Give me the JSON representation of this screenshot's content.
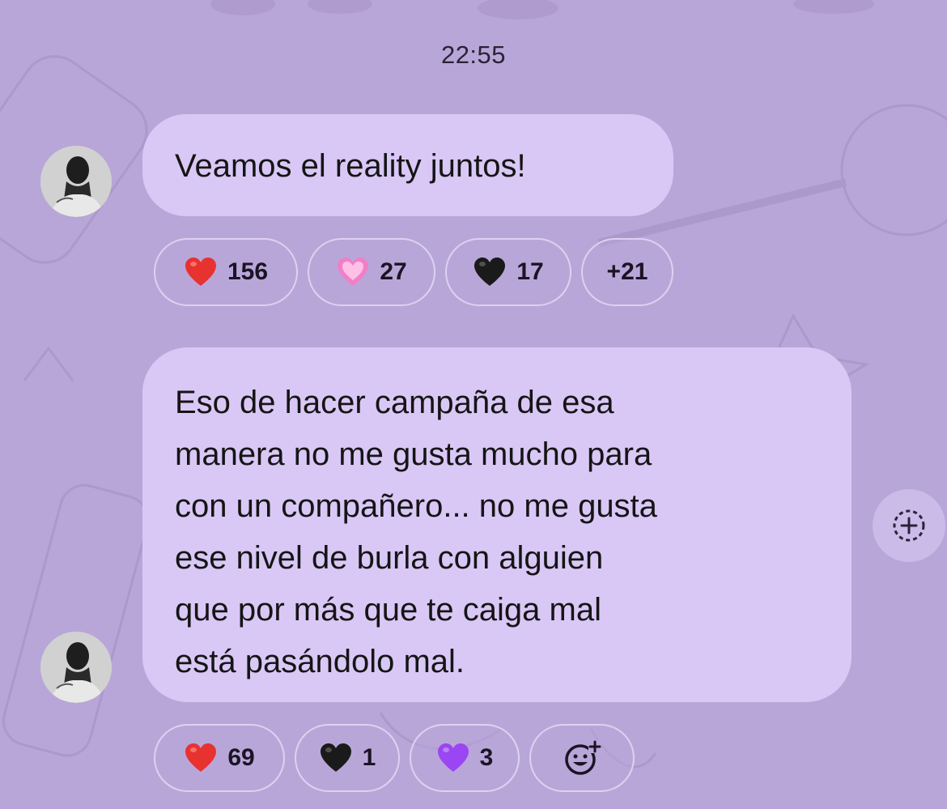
{
  "timestamp": "22:55",
  "messages": [
    {
      "text": "Veamos el reality juntos!",
      "reactions": [
        {
          "emoji": "red-heart",
          "count": "156"
        },
        {
          "emoji": "pink-heart",
          "count": "27"
        },
        {
          "emoji": "black-heart",
          "count": "17"
        }
      ],
      "more_label": "+21"
    },
    {
      "lines": [
        "Eso de hacer campaña de esa",
        "manera no me gusta mucho para",
        "con un compañero... no me gusta",
        "ese nivel de burla con alguien",
        "que por más que te caiga mal",
        "está pasándolo mal."
      ],
      "reactions": [
        {
          "emoji": "red-heart",
          "count": "69"
        },
        {
          "emoji": "black-heart",
          "count": "1"
        },
        {
          "emoji": "purple-heart",
          "count": "3"
        }
      ],
      "add_reaction_icon": "smiley-plus-icon"
    }
  ],
  "side_action_icon": "add-reaction-circle-icon",
  "colors": {
    "background": "#b9a6d8",
    "bubble": "#d9c8f6",
    "red_heart": "#e8322f",
    "pink_heart": "#f07fc8",
    "black_heart": "#1a1a1a",
    "purple_heart": "#9a46f2"
  }
}
